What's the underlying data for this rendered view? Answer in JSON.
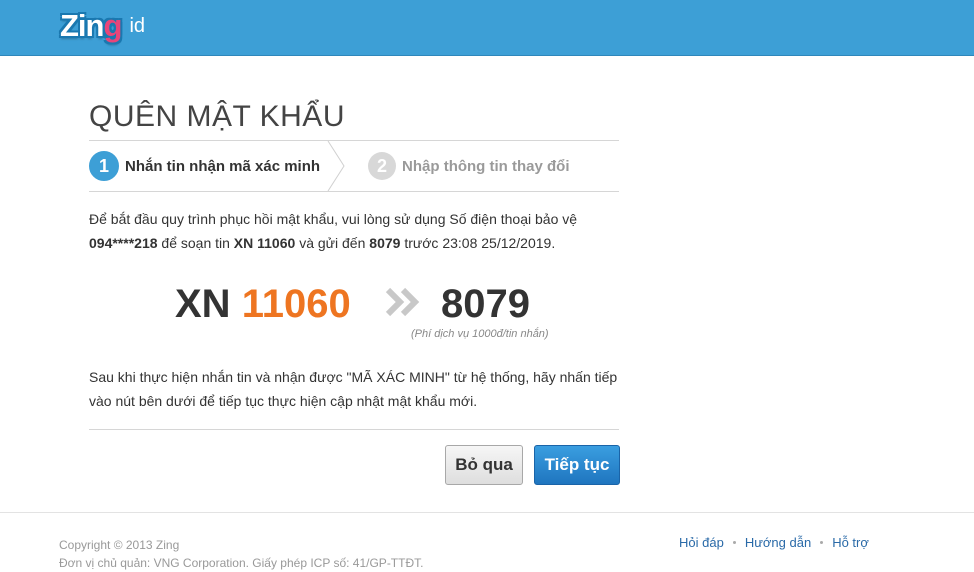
{
  "header": {
    "logo_zing_a": "Zin",
    "logo_zing_b": "g",
    "logo_id": "id"
  },
  "page": {
    "title": "QUÊN MẬT KHẨU"
  },
  "steps": [
    {
      "num": "1",
      "label": "Nhắn tin nhận mã xác minh",
      "active": true
    },
    {
      "num": "2",
      "label": "Nhập thông tin thay đổi",
      "active": false
    }
  ],
  "intro": {
    "part1": "Để bắt đầu quy trình phục hồi mật khẩu, vui lòng sử dụng Số điện thoại bảo vệ",
    "phone": "094****218",
    "part2": "để soạn tin",
    "code": "XN 11060",
    "part3": "và gửi đến",
    "to": "8079",
    "part4": "trước 23:08 25/12/2019."
  },
  "sms": {
    "prefix": "XN",
    "number": "11060",
    "to": "8079",
    "fee": "(Phí dịch vụ 1000đ/tin nhắn)"
  },
  "after_text": "Sau khi thực hiện nhắn tin và nhận được \"MÃ XÁC MINH\" từ hệ thống, hãy nhấn tiếp vào nút bên dưới để tiếp tục thực hiện cập nhật mật khẩu mới.",
  "buttons": {
    "skip": "Bỏ qua",
    "next": "Tiếp tục"
  },
  "footer": {
    "copyright": "Copyright © 2013 Zing",
    "owner": "Đơn vị chủ quản: VNG Corporation. Giấy phép ICP số: 41/GP-TTĐT.",
    "links": [
      "Hỏi đáp",
      "Hướng dẫn",
      "Hỗ trợ"
    ]
  },
  "colors": {
    "header_bg": "#3d9fd6",
    "accent_orange": "#ee7521",
    "primary_button": "#2a86cf"
  }
}
